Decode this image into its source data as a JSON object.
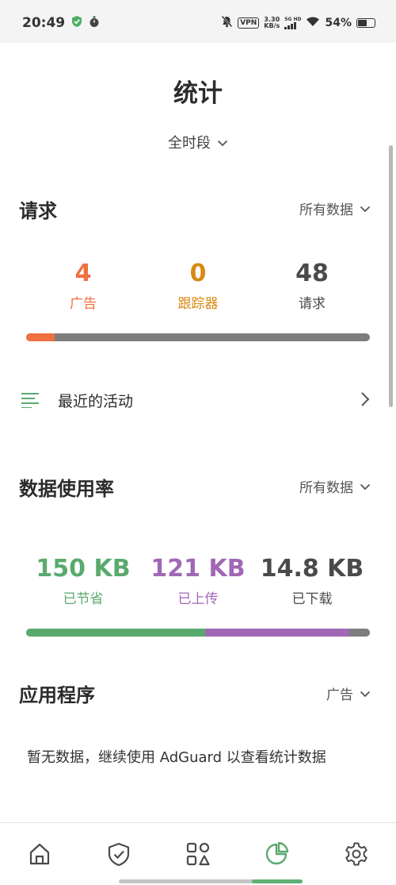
{
  "status_bar": {
    "time": "20:49",
    "vpn": "VPN",
    "speed_value": "3.30",
    "speed_unit": "KB/s",
    "network": "5G HD",
    "battery": "54%"
  },
  "page": {
    "title": "统计",
    "period": "全时段"
  },
  "requests": {
    "title": "请求",
    "filter": "所有数据",
    "stats": [
      {
        "value": "4",
        "label": "广告",
        "color": "#f07040"
      },
      {
        "value": "0",
        "label": "跟踪器",
        "color": "#d88a12"
      },
      {
        "value": "48",
        "label": "请求",
        "color": "#4a4a4a"
      }
    ],
    "bar_fractions": {
      "ads": 0.0833,
      "trackers": 0.0
    },
    "colors": {
      "ads": "#f07040",
      "rest": "#7d7d7d"
    }
  },
  "recent_activity": {
    "label": "最近的活动"
  },
  "data_usage": {
    "title": "数据使用率",
    "filter": "所有数据",
    "stats": [
      {
        "value": "150 KB",
        "label": "已节省",
        "color": "#5aaa6e"
      },
      {
        "value": "121 KB",
        "label": "已上传",
        "color": "#a167b5"
      },
      {
        "value": "14.8 KB",
        "label": "已下载",
        "color": "#4a4a4a"
      }
    ],
    "bar_fractions": {
      "saved": 0.5203,
      "uploaded": 0.4197,
      "downloaded": 0.06
    },
    "colors": {
      "saved": "#5aaa6e",
      "uploaded": "#a167b5",
      "downloaded": "#7d7d7d"
    }
  },
  "apps": {
    "title": "应用程序",
    "filter": "广告",
    "empty_text": "暂无数据，继续使用 AdGuard 以查看统计数据"
  },
  "nav": {
    "items": [
      {
        "name": "home",
        "active": false
      },
      {
        "name": "protection",
        "active": false
      },
      {
        "name": "apps",
        "active": false
      },
      {
        "name": "statistics",
        "active": true
      },
      {
        "name": "settings",
        "active": false
      }
    ],
    "active_color": "#5aaa6e",
    "inactive_color": "#4a4a4a"
  }
}
